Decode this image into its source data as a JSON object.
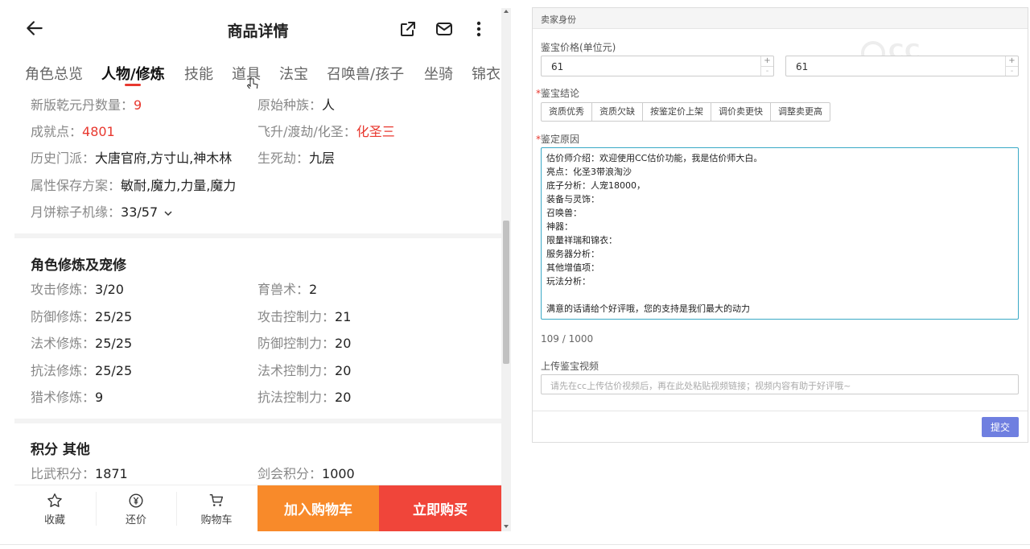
{
  "left": {
    "title": "商品详情",
    "tabs": [
      {
        "label": "角色总览"
      },
      {
        "label": "人物/修炼"
      },
      {
        "label": "技能"
      },
      {
        "label": "道具"
      },
      {
        "label": "法宝"
      },
      {
        "label": "召唤兽/孩子"
      },
      {
        "label": "坐骑"
      },
      {
        "label": "锦衣"
      }
    ],
    "info": {
      "qianyuan": {
        "k": "新版乾元丹数量：",
        "v": "9"
      },
      "race": {
        "k": "原始种族：",
        "v": "人"
      },
      "achievement": {
        "k": "成就点：",
        "v": "4801"
      },
      "ascension": {
        "k": "飞升/渡劫/化圣：",
        "v": "化圣三"
      },
      "school": {
        "k": "历史门派：",
        "v": "大唐官府,方寸山,神木林"
      },
      "trial": {
        "k": "生死劫：",
        "v": "九层"
      },
      "attr_plan": {
        "k": "属性保存方案：",
        "v": "敏耐,魔力,力量,魔力"
      },
      "mooncake": {
        "k": "月饼粽子机缘：",
        "v": "33/57"
      }
    },
    "cultivation": {
      "title": "角色修炼及宠修",
      "rows": [
        {
          "k": "攻击修炼：",
          "v": "3/20"
        },
        {
          "k": "育兽术：",
          "v": "2"
        },
        {
          "k": "防御修炼：",
          "v": "25/25"
        },
        {
          "k": "攻击控制力：",
          "v": "21"
        },
        {
          "k": "法术修炼：",
          "v": "25/25"
        },
        {
          "k": "防御控制力：",
          "v": "20"
        },
        {
          "k": "抗法修炼：",
          "v": "25/25"
        },
        {
          "k": "法术控制力：",
          "v": "20"
        },
        {
          "k": "猎术修炼：",
          "v": "9"
        },
        {
          "k": "抗法控制力：",
          "v": "20"
        }
      ]
    },
    "points": {
      "title": "积分 其他",
      "rows": [
        {
          "k": "比武积分：",
          "v": "1871"
        },
        {
          "k": "剑会积分：",
          "v": "1000"
        }
      ]
    },
    "bottom": {
      "favorite": "收藏",
      "bargain": "还价",
      "cart": "购物车",
      "add_cart": "加入购物车",
      "buy_now": "立即购买"
    }
  },
  "form": {
    "panel_title": "卖家身份",
    "price_label": "鉴宝价格(单位元)",
    "price1": "61",
    "price2": "61",
    "conclusion_label": "鉴宝结论",
    "conclusion_options": [
      "资质优秀",
      "资质欠缺",
      "按鉴定价上架",
      "调价卖更快",
      "调整卖更高"
    ],
    "reason_label": "鉴定原因",
    "reason_text": "估价师介绍：欢迎使用CC估价功能，我是估价师大白。\n亮点：化圣3带浪淘沙\n底子分析：人宠18000，\n装备与灵饰：\n召唤兽：\n神器：\n限量祥瑞和锦衣：\n服务器分析：\n其他增值项：\n玩法分析：\n\n满意的话请给个好评哦，您的支持是我们最大的动力",
    "counter": "109 / 1000",
    "video_label": "上传鉴宝视频",
    "video_placeholder": "请先在cc上传估价视频后，再在此处粘贴视频链接；视频内容有助于好评哦~",
    "submit": "提交",
    "required_mark": "*"
  },
  "colors": {
    "accent_red": "#e8382f",
    "cart_orange": "#f88a2a",
    "buy_red": "#f0453a",
    "submit_blue": "#6f7fe0",
    "focus_border": "#3aa9c6"
  }
}
